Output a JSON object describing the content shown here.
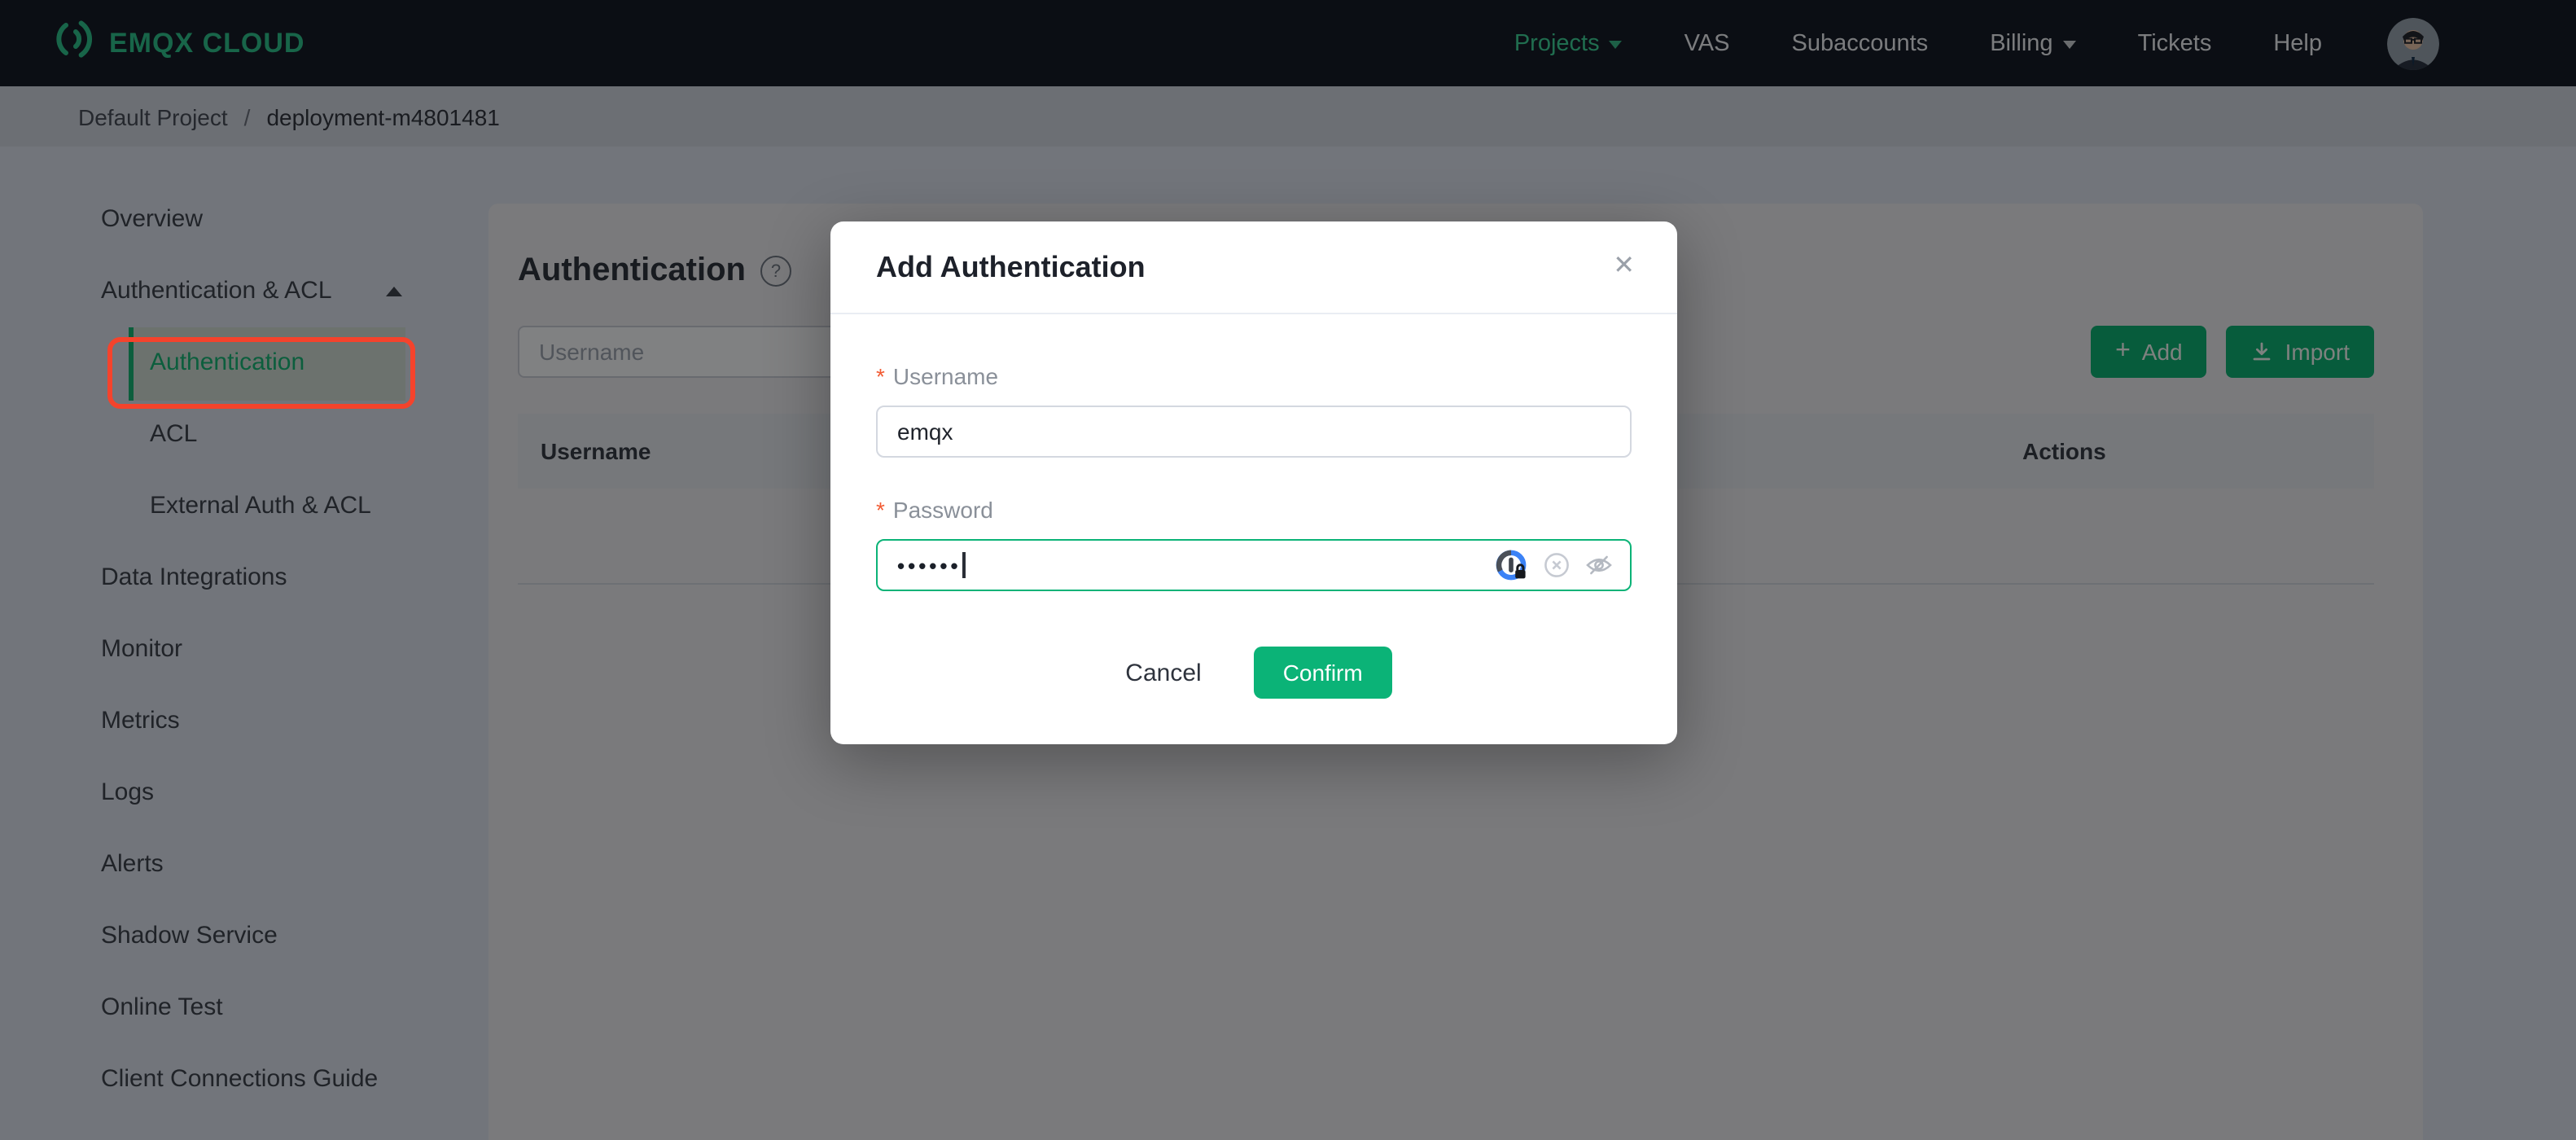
{
  "navbar": {
    "logo_text": "EMQX CLOUD",
    "items": [
      {
        "label": "Projects",
        "active": true,
        "has_caret": true
      },
      {
        "label": "VAS",
        "active": false,
        "has_caret": false
      },
      {
        "label": "Subaccounts",
        "active": false,
        "has_caret": false
      },
      {
        "label": "Billing",
        "active": false,
        "has_caret": true
      },
      {
        "label": "Tickets",
        "active": false,
        "has_caret": false
      },
      {
        "label": "Help",
        "active": false,
        "has_caret": false
      }
    ]
  },
  "breadcrumb": {
    "project": "Default Project",
    "separator": "/",
    "deployment": "deployment-m4801481"
  },
  "sidebar": {
    "items": [
      {
        "label": "Overview"
      },
      {
        "label": "Authentication & ACL",
        "expanded": true
      },
      {
        "label": "Authentication",
        "active": true,
        "sub": true
      },
      {
        "label": "ACL",
        "sub": true
      },
      {
        "label": "External Auth & ACL",
        "sub": true
      },
      {
        "label": "Data Integrations"
      },
      {
        "label": "Monitor"
      },
      {
        "label": "Metrics"
      },
      {
        "label": "Logs"
      },
      {
        "label": "Alerts"
      },
      {
        "label": "Shadow Service"
      },
      {
        "label": "Online Test"
      },
      {
        "label": "Client Connections Guide"
      }
    ]
  },
  "main": {
    "title": "Authentication",
    "help_glyph": "?",
    "search_placeholder": "Username",
    "add_label": "Add",
    "add_glyph": "+",
    "import_label": "Import",
    "table": {
      "columns": [
        "Username",
        "Actions"
      ],
      "rows": []
    }
  },
  "modal": {
    "title": "Add Authentication",
    "close_glyph": "✕",
    "required_mark": "*",
    "username": {
      "label": "Username",
      "value": "emqx",
      "required": true
    },
    "password": {
      "label": "Password",
      "value": "••••••",
      "masked": true,
      "required": true,
      "icons": [
        "onepassword",
        "clear",
        "eye-off"
      ]
    },
    "cancel_label": "Cancel",
    "confirm_label": "Confirm"
  },
  "colors": {
    "accent_green": "#0bb377",
    "logo_green": "#2fbf8a",
    "navbar_bg": "#161c26",
    "annotation_red": "#f5432c",
    "required_red": "#f25b33",
    "focus_border_green": "#0bb377"
  }
}
